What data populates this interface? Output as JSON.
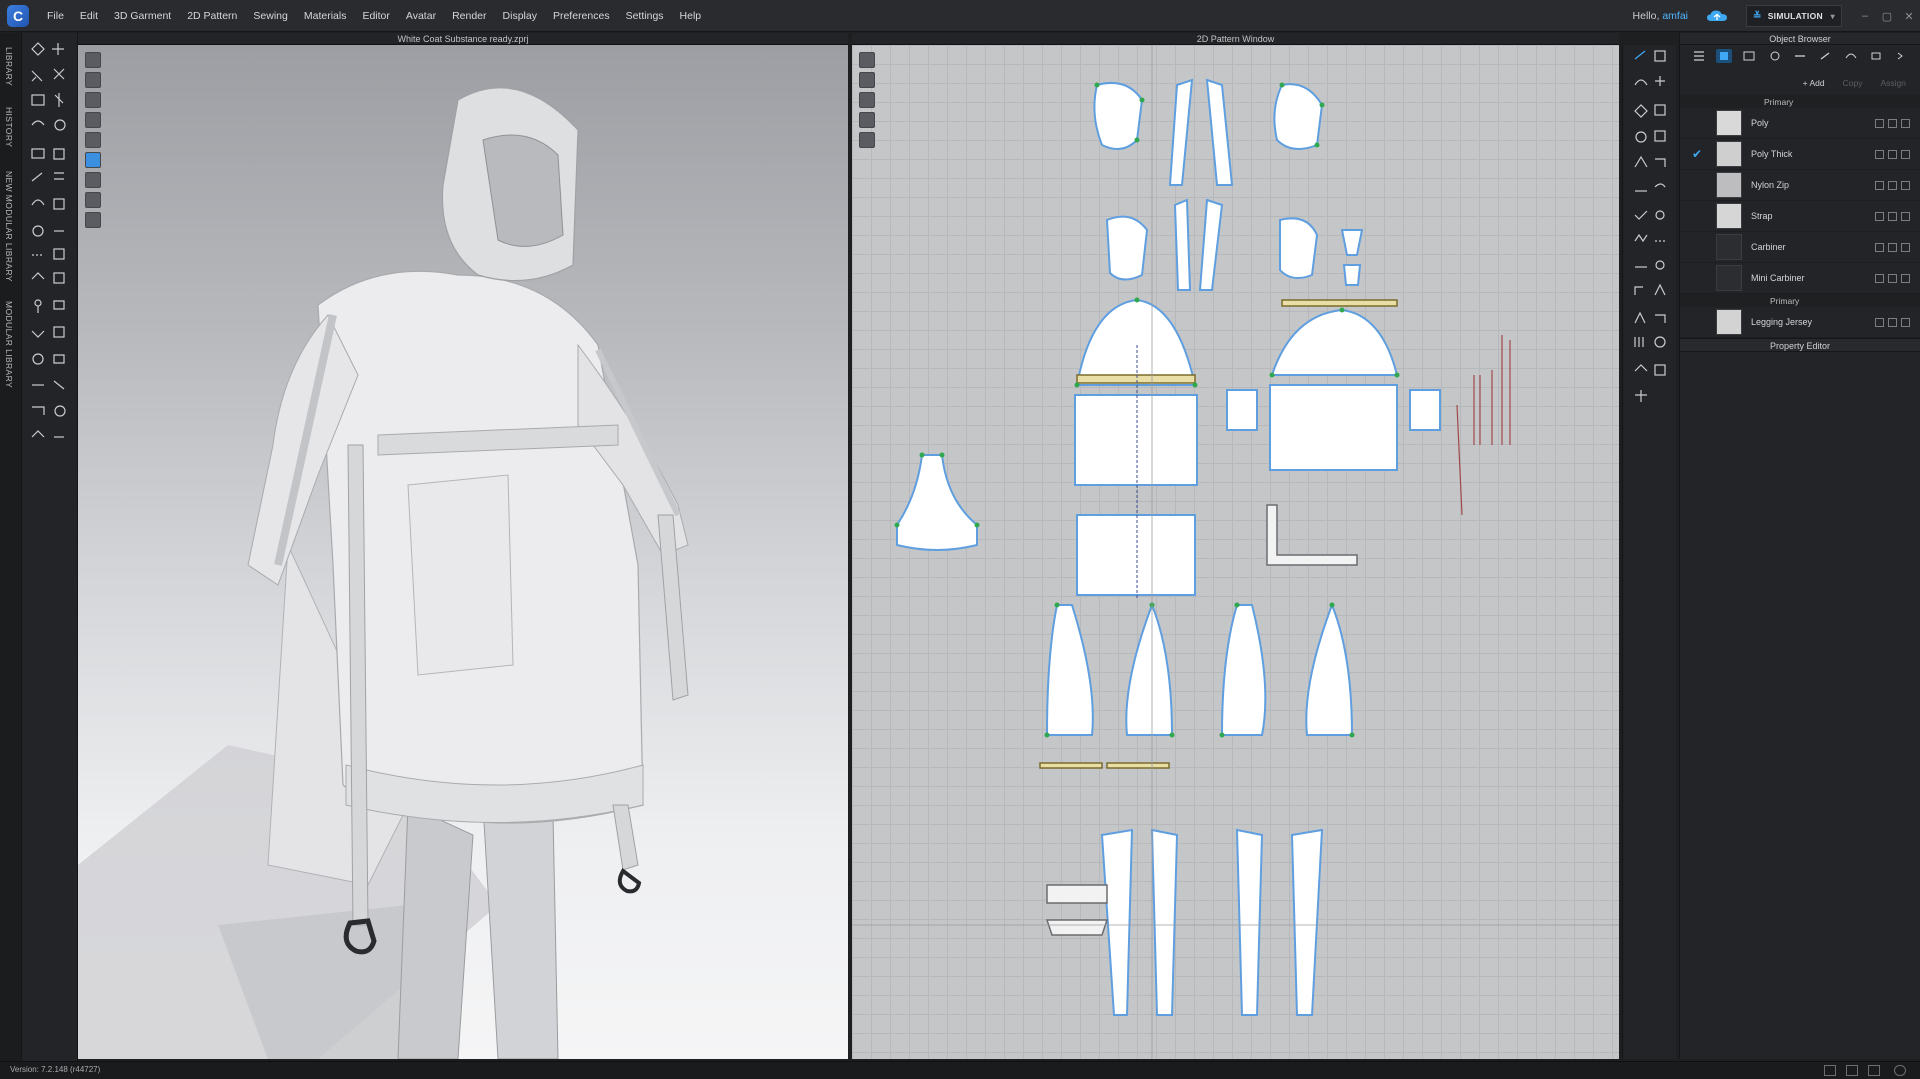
{
  "app": {
    "menu": [
      "File",
      "Edit",
      "3D Garment",
      "2D Pattern",
      "Sewing",
      "Materials",
      "Editor",
      "Avatar",
      "Render",
      "Display",
      "Preferences",
      "Settings",
      "Help"
    ],
    "greeting": "Hello,",
    "username": "amfai",
    "mode": "SIMULATION"
  },
  "side_tabs": [
    "LIBRARY",
    "HISTORY",
    "NEW MODULAR LIBRARY",
    "MODULAR LIBRARY"
  ],
  "viewport_3d": {
    "title": "White Coat Substance ready.zprj"
  },
  "viewport_2d": {
    "title": "2D Pattern Window"
  },
  "object_browser": {
    "title": "Object Browser",
    "add_label": "+ Add",
    "copy_label": "Copy",
    "assign_label": "Assign",
    "section_label": "Primary",
    "fabrics": [
      {
        "name": "Poly",
        "selected": false,
        "thumb": "#d9d9d9"
      },
      {
        "name": "Poly Thick",
        "selected": true,
        "thumb": "#cfcfcf"
      },
      {
        "name": "Nylon Zip",
        "selected": false,
        "thumb": "#bdbdbf"
      },
      {
        "name": "Strap",
        "selected": false,
        "thumb": "#d6d6d6"
      },
      {
        "name": "Carbiner",
        "selected": false,
        "thumb": "#2c2d30"
      },
      {
        "name": "Mini Carbiner",
        "selected": false,
        "thumb": "#2c2d30"
      }
    ],
    "section2_label": "Primary",
    "fabrics2": [
      {
        "name": "Legging Jersey",
        "selected": false,
        "thumb": "#d3d3d3"
      }
    ],
    "property_editor_title": "Property Editor"
  },
  "status": {
    "version": "Version: 7.2.148 (r44727)"
  },
  "colors": {
    "accent": "#3fa9f5",
    "pattern_outline": "#5f9fe0",
    "pattern_point": "#2fa84f",
    "menu_bg": "#2a2b2e"
  },
  "icons": [
    "app-logo-icon",
    "cloud-icon",
    "simulation-icon",
    "minimize-icon",
    "maximize-icon",
    "close-icon",
    "check-icon"
  ]
}
